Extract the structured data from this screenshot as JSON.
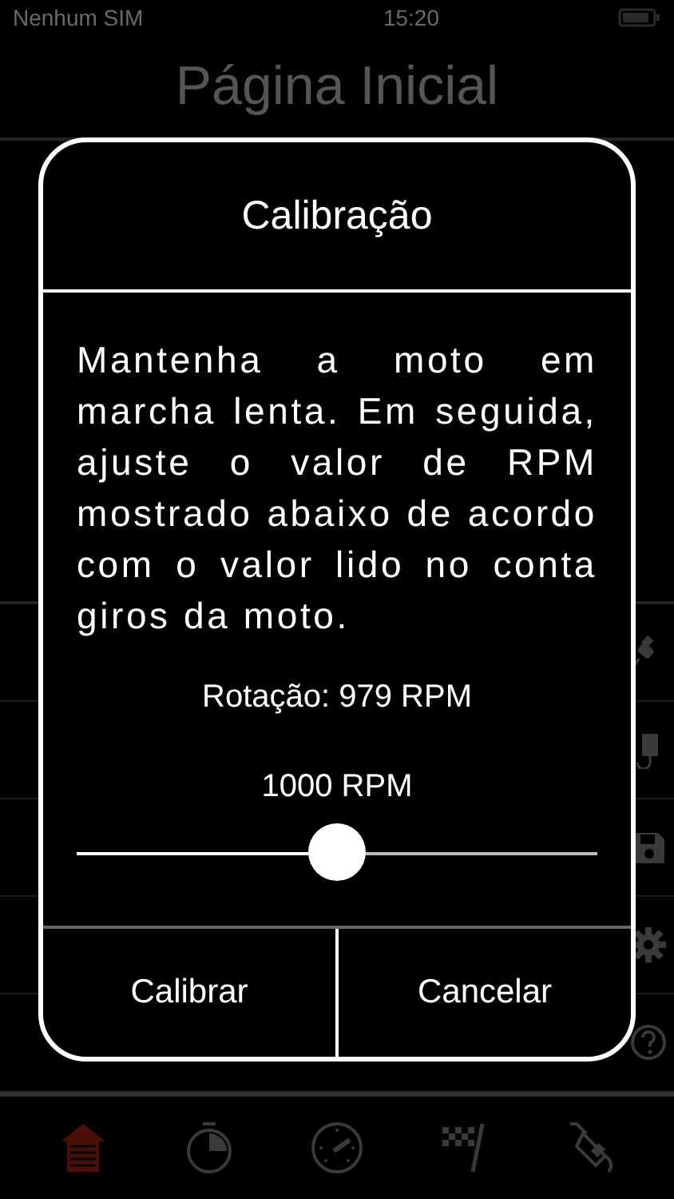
{
  "status_bar": {
    "carrier": "Nenhum SIM",
    "time": "15:20"
  },
  "nav_bar": {
    "title": "Página Inicial"
  },
  "side_rows": [
    {
      "kind": "plug"
    },
    {
      "kind": "device"
    },
    {
      "kind": "save"
    },
    {
      "kind": "gear"
    },
    {
      "kind": "help"
    }
  ],
  "tab_bar": [
    {
      "kind": "home",
      "selected": true
    },
    {
      "kind": "stopwatch",
      "selected": false
    },
    {
      "kind": "gauge",
      "selected": false
    },
    {
      "kind": "flag",
      "selected": false
    },
    {
      "kind": "fuel",
      "selected": false
    }
  ],
  "dialog": {
    "title": "Calibração",
    "message": "Mantenha a moto em marcha lenta. Em seguida, ajuste o valor de RPM mostrado abaixo de acordo com o valor lido no conta giros da moto.",
    "reading": "Rotação: 979 RPM",
    "slider_value": "1000 RPM",
    "slider": {
      "level": 0.5
    },
    "buttons": [
      "Calibrar",
      "Cancelar"
    ]
  }
}
